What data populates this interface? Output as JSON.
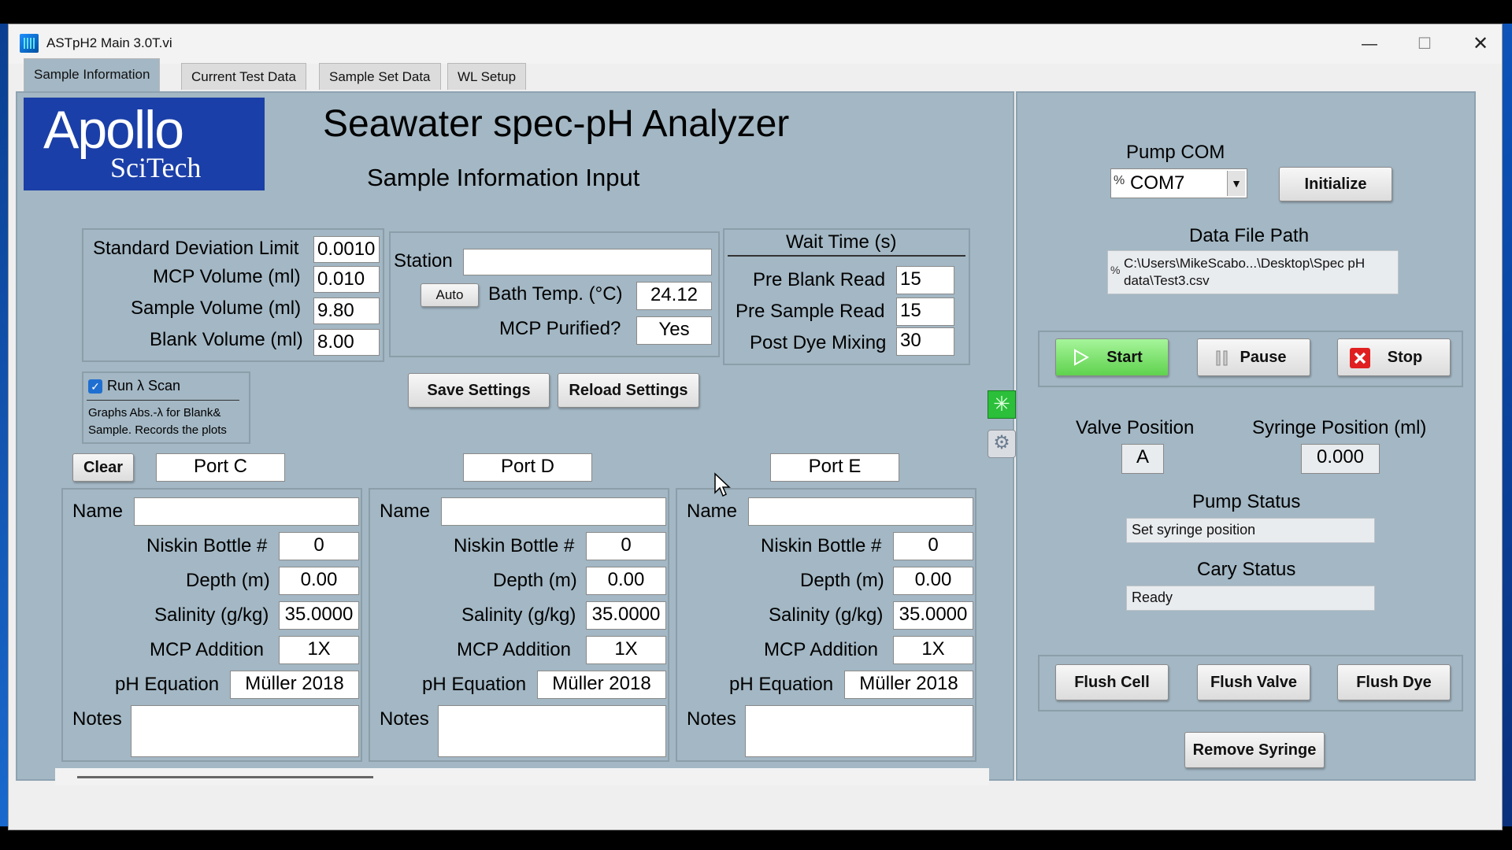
{
  "window": {
    "title": "ASTpH2 Main 3.0T.vi"
  },
  "tabs": [
    {
      "label": "Sample Information",
      "active": true
    },
    {
      "label": "Current Test Data",
      "active": false
    },
    {
      "label": "Sample Set Data",
      "active": false
    },
    {
      "label": "WL Setup",
      "active": false
    }
  ],
  "logo": {
    "big": "Apollo",
    "small": "SciTech"
  },
  "header": {
    "title": "Seawater spec-pH Analyzer",
    "subtitle": "Sample Information Input"
  },
  "settings": {
    "std_dev_label": "Standard Deviation Limit",
    "std_dev_value": "0.0010",
    "mcp_vol_label": "MCP Volume (ml)",
    "mcp_vol_value": "0.010",
    "sample_vol_label": "Sample Volume (ml)",
    "sample_vol_value": "9.80",
    "blank_vol_label": "Blank Volume (ml)",
    "blank_vol_value": "8.00"
  },
  "station": {
    "station_label": "Station",
    "station_value": "",
    "auto_label": "Auto",
    "bath_label": "Bath Temp. (°C)",
    "bath_value": "24.12",
    "purified_label": "MCP Purified?",
    "purified_value": "Yes"
  },
  "wait": {
    "title": "Wait Time (s)",
    "pre_blank_label": "Pre Blank Read",
    "pre_blank_value": "15",
    "pre_sample_label": "Pre Sample Read",
    "pre_sample_value": "15",
    "post_dye_label": "Post Dye Mixing",
    "post_dye_value": "30"
  },
  "scan": {
    "checkbox_label": "Run λ Scan",
    "checked": true,
    "desc1": "Graphs Abs.-λ for Blank&",
    "desc2": "Sample. Records the plots"
  },
  "buttons": {
    "save": "Save Settings",
    "reload": "Reload Settings",
    "clear": "Clear",
    "initialize": "Initialize",
    "start": "Start",
    "pause": "Pause",
    "stop": "Stop",
    "flush_cell": "Flush Cell",
    "flush_valve": "Flush Valve",
    "flush_dye": "Flush Dye",
    "remove_syringe": "Remove Syringe"
  },
  "ports": [
    {
      "port": "Port C",
      "name_label": "Name",
      "name": "",
      "niskin_label": "Niskin Bottle #",
      "niskin": "0",
      "depth_label": "Depth (m)",
      "depth": "0.00",
      "salinity_label": "Salinity (g/kg)",
      "salinity": "35.0000",
      "mcp_label": "MCP Addition",
      "mcp": "1X",
      "ph_label": "pH Equation",
      "ph": "Müller 2018",
      "notes_label": "Notes",
      "notes": ""
    },
    {
      "port": "Port D",
      "name_label": "Name",
      "name": "",
      "niskin_label": "Niskin Bottle #",
      "niskin": "0",
      "depth_label": "Depth (m)",
      "depth": "0.00",
      "salinity_label": "Salinity (g/kg)",
      "salinity": "35.0000",
      "mcp_label": "MCP Addition",
      "mcp": "1X",
      "ph_label": "pH Equation",
      "ph": "Müller 2018",
      "notes_label": "Notes",
      "notes": ""
    },
    {
      "port": "Port E",
      "name_label": "Name",
      "name": "",
      "niskin_label": "Niskin Bottle #",
      "niskin": "0",
      "depth_label": "Depth (m)",
      "depth": "0.00",
      "salinity_label": "Salinity (g/kg)",
      "salinity": "35.0000",
      "mcp_label": "MCP Addition",
      "mcp": "1X",
      "ph_label": "pH Equation",
      "ph": "Müller 2018",
      "notes_label": "Notes",
      "notes": ""
    }
  ],
  "pump": {
    "com_label": "Pump COM",
    "com_value": "COM7",
    "com_prefix": "%"
  },
  "file": {
    "label": "Data File Path",
    "prefix": "%",
    "line1": "C:\\Users\\MikeScabo...\\Desktop\\Spec pH",
    "line2": "data\\Test3.csv"
  },
  "valve": {
    "label": "Valve Position",
    "value": "A"
  },
  "syringe": {
    "label": "Syringe Position (ml)",
    "value": "0.000"
  },
  "pump_status": {
    "label": "Pump Status",
    "value": "Set syringe position"
  },
  "cary_status": {
    "label": "Cary Status",
    "value": "Ready"
  },
  "colors": {
    "panel": "#a3b7c4",
    "logo_bg": "#1b3fa8",
    "start_green": "#7de36a",
    "stop_red": "#e02020"
  }
}
